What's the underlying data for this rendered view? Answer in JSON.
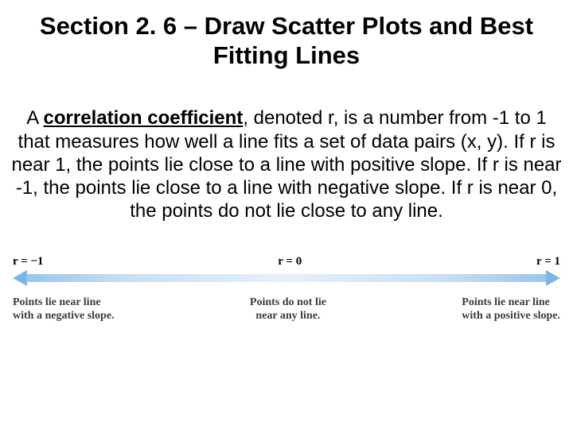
{
  "title": "Section 2. 6 – Draw Scatter Plots and Best Fitting Lines",
  "body": {
    "lead": "A ",
    "term": "correlation coefficient",
    "rest": ", denoted r, is a number from -1 to 1 that measures how well a line fits a set of data pairs (x, y).  If r is near 1, the points lie close to a line with positive slope.  If r is near -1, the points lie close to a line with negative slope.  If r is near 0, the points do not lie close to any line."
  },
  "diagram": {
    "top_left": "r = −1",
    "top_mid": "r = 0",
    "top_right": "r = 1",
    "bottom_left_l1": "Points lie near line",
    "bottom_left_l2": "with a negative slope.",
    "bottom_mid_l1": "Points do not lie",
    "bottom_mid_l2": "near any line.",
    "bottom_right_l1": "Points lie near line",
    "bottom_right_l2": "with a positive slope."
  }
}
